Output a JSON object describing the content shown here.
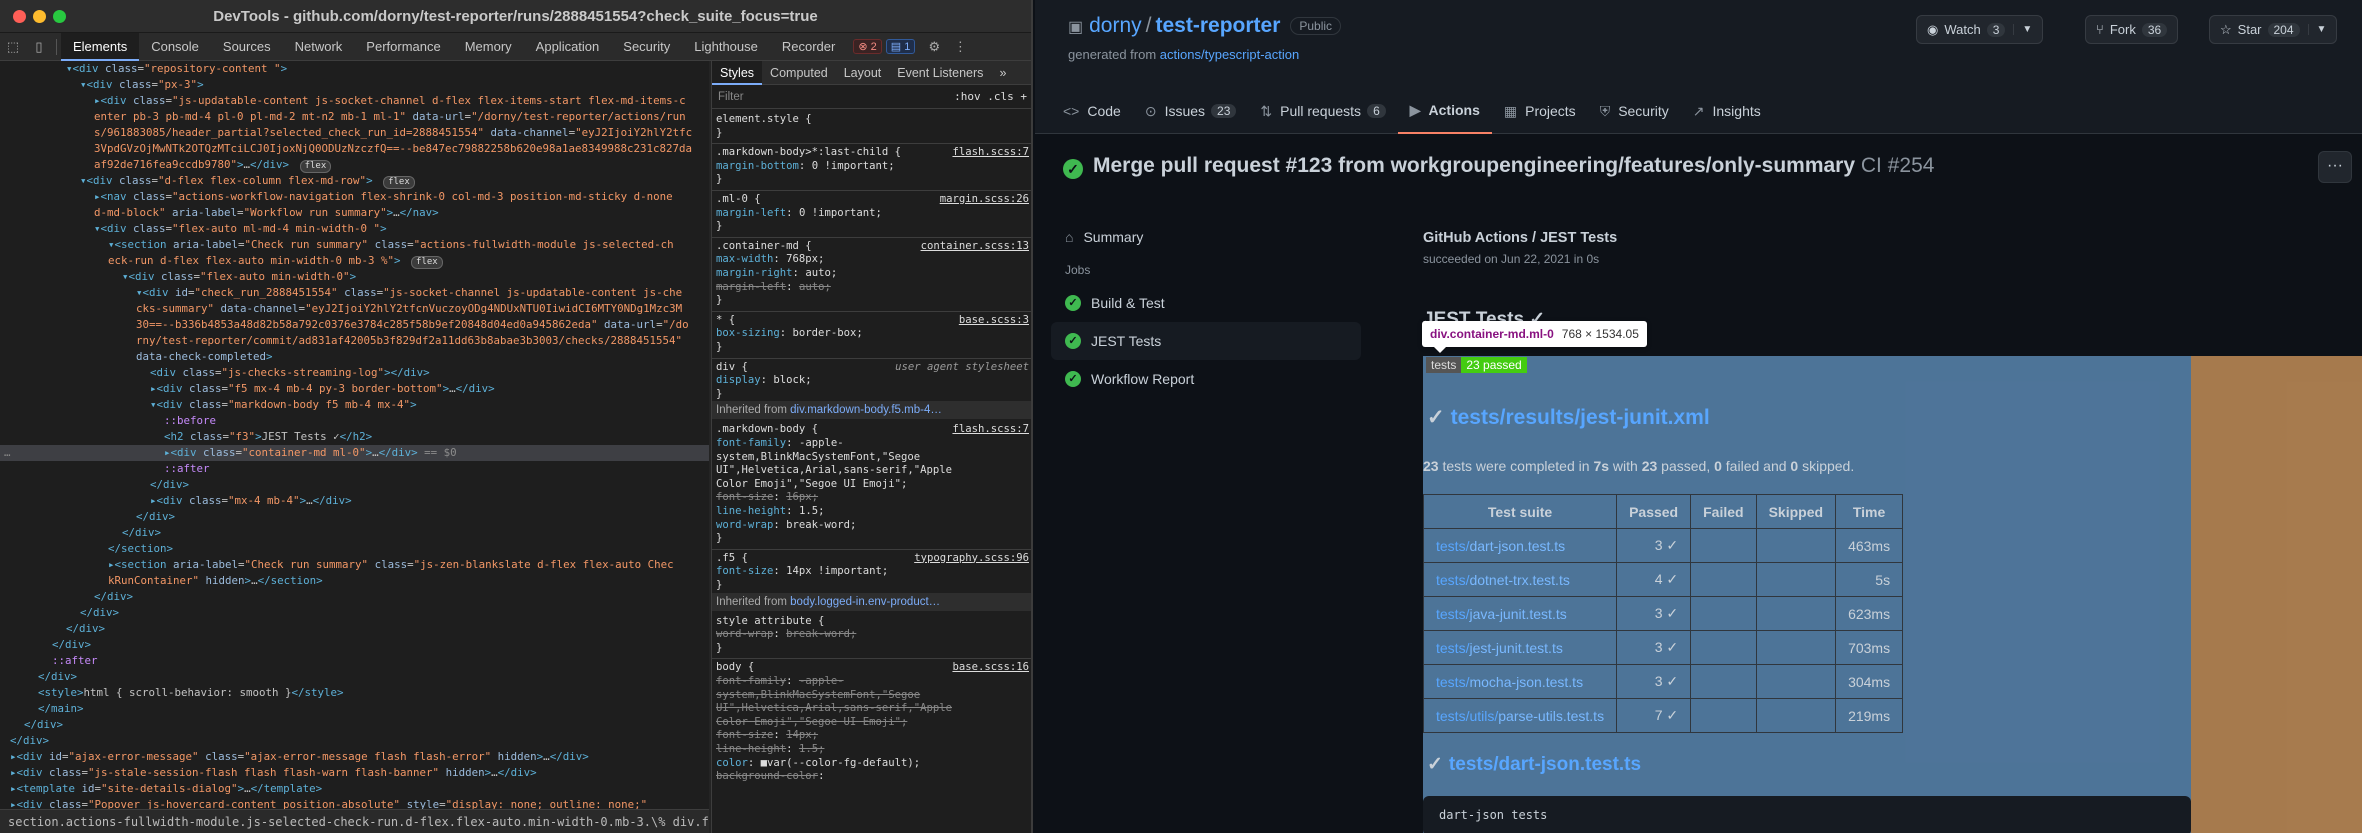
{
  "devtools": {
    "window_title": "DevTools - github.com/dorny/test-reporter/runs/2888451554?check_suite_focus=true",
    "tabs": [
      "Elements",
      "Console",
      "Sources",
      "Network",
      "Performance",
      "Memory",
      "Application",
      "Security",
      "Lighthouse",
      "Recorder"
    ],
    "active_tab": "Elements",
    "errors_count": "2",
    "messages_count": "1",
    "dom_lines": [
      {
        "i": 4,
        "h": "<span class='tg'>▾&lt;div </span><span class='an'>class</span>=<span class='av'>\"repository-content \"</span><span class='tg'>&gt;</span>"
      },
      {
        "i": 5,
        "h": "<span class='tg'>▾&lt;div </span><span class='an'>class</span>=<span class='av'>\"px-3\"</span><span class='tg'>&gt;</span>"
      },
      {
        "i": 6,
        "h": "<span class='tg'>▸&lt;div </span><span class='an'>class</span>=<span class='av'>\"js-updatable-content js-socket-channel d-flex flex-items-start flex-md-items-c</span>"
      },
      {
        "i": 6,
        "h": "<span class='av'>enter pb-3 pb-md-4 pl-0 pl-md-2 mt-n2 mb-1 ml-1\"</span> <span class='an'>data-url</span>=<span class='av'>\"/dorny/test-reporter/actions/run</span>"
      },
      {
        "i": 6,
        "h": "<span class='av'>s/961883085/header_partial?selected_check_run_id=2888451554\"</span> <span class='an'>data-channel</span>=<span class='av'>\"eyJ2IjoiY2hlY2tfc</span>"
      },
      {
        "i": 6,
        "h": "<span class='av'>3VpdGVzOjMwNTk2OTQzMTciLCJ0IjoxNjQ0ODUzNzczfQ==--be847ec79882258b620e98a1ae8349988c231c827da</span>"
      },
      {
        "i": 6,
        "h": "<span class='av'>af92de716fea9ccdb9780\"</span><span class='tg'>&gt;</span>…<span class='tg'>&lt;/div&gt;</span> <span class='flexb'>flex</span>"
      },
      {
        "i": 5,
        "h": "<span class='tg'>▾&lt;div </span><span class='an'>class</span>=<span class='av'>\"d-flex flex-column flex-md-row\"</span><span class='tg'>&gt;</span> <span class='flexb'>flex</span>"
      },
      {
        "i": 6,
        "h": "<span class='tg'>▸&lt;nav </span><span class='an'>class</span>=<span class='av'>\"actions-workflow-navigation flex-shrink-0 col-md-3 position-md-sticky d-none</span>"
      },
      {
        "i": 6,
        "h": "<span class='av'>d-md-block\"</span> <span class='an'>aria-label</span>=<span class='av'>\"Workflow run summary\"</span><span class='tg'>&gt;</span>…<span class='tg'>&lt;/nav&gt;</span>"
      },
      {
        "i": 6,
        "h": "<span class='tg'>▾&lt;div </span><span class='an'>class</span>=<span class='av'>\"flex-auto ml-md-4 min-width-0 \"</span><span class='tg'>&gt;</span>"
      },
      {
        "i": 7,
        "h": "<span class='tg'>▾&lt;section </span><span class='an'>aria-label</span>=<span class='av'>\"Check run summary\"</span> <span class='an'>class</span>=<span class='av'>\"actions-fullwidth-module js-selected-ch</span>"
      },
      {
        "i": 7,
        "h": "<span class='av'>eck-run d-flex flex-auto min-width-0 mb-3 %\"</span><span class='tg'>&gt;</span> <span class='flexb'>flex</span>"
      },
      {
        "i": 8,
        "h": "<span class='tg'>▾&lt;div </span><span class='an'>class</span>=<span class='av'>\"flex-auto min-width-0\"</span><span class='tg'>&gt;</span>"
      },
      {
        "i": 9,
        "h": "<span class='tg'>▾&lt;div </span><span class='an'>id</span>=<span class='av'>\"check_run_2888451554\"</span> <span class='an'>class</span>=<span class='av'>\"js-socket-channel js-updatable-content js-che</span>"
      },
      {
        "i": 9,
        "h": "<span class='av'>cks-summary\"</span> <span class='an'>data-channel</span>=<span class='av'>\"eyJ2IjoiY2hlY2tfcnVuczoyODg4NDUxNTU0IiwidCI6MTY0NDg1Mzc3M</span>"
      },
      {
        "i": 9,
        "h": "<span class='av'>30==--b336b4853a48d82b58a792c0376e3784c285f58b9ef20848d04ed0a945862eda\"</span> <span class='an'>data-url</span>=<span class='av'>\"/do</span>"
      },
      {
        "i": 9,
        "h": "<span class='av'>rny/test-reporter/commit/ad831af42005b3f829df2a11dd63b8abae3b3003/checks/2888451554\"</span>"
      },
      {
        "i": 9,
        "h": "<span class='an'>data-check-completed</span><span class='tg'>&gt;</span>"
      },
      {
        "i": 10,
        "h": "<span class='tg'>&lt;div </span><span class='an'>class</span>=<span class='av'>\"js-checks-streaming-log\"</span><span class='tg'>&gt;&lt;/div&gt;</span>"
      },
      {
        "i": 10,
        "h": "<span class='tg'>▸&lt;div </span><span class='an'>class</span>=<span class='av'>\"f5 mx-4 mb-4 py-3 border-bottom\"</span><span class='tg'>&gt;</span>…<span class='tg'>&lt;/div&gt;</span>"
      },
      {
        "i": 10,
        "h": "<span class='tg'>▾&lt;div </span><span class='an'>class</span>=<span class='av'>\"markdown-body f5 mb-4 mx-4\"</span><span class='tg'>&gt;</span>"
      },
      {
        "i": 11,
        "h": "<span class='pe'>::before</span>"
      },
      {
        "i": 11,
        "h": "<span class='tg'>&lt;h2 </span><span class='an'>class</span>=<span class='av'>\"f3\"</span><span class='tg'>&gt;</span>JEST Tests ✓<span class='tg'>&lt;/h2&gt;</span>"
      },
      {
        "i": 11,
        "h": "<span class='tg'>▸&lt;div </span><span class='an'>class</span>=<span class='av'>\"container-md ml-0\"</span><span class='tg'>&gt;</span>…<span class='tg'>&lt;/div&gt;</span> <span class='ar'>== $0</span>",
        "sel": true
      },
      {
        "i": 11,
        "h": "<span class='pe'>::after</span>"
      },
      {
        "i": 10,
        "h": "<span class='tg'>&lt;/div&gt;</span>"
      },
      {
        "i": 10,
        "h": "<span class='tg'>▸&lt;div </span><span class='an'>class</span>=<span class='av'>\"mx-4 mb-4\"</span><span class='tg'>&gt;</span>…<span class='tg'>&lt;/div&gt;</span>"
      },
      {
        "i": 9,
        "h": "<span class='tg'>&lt;/div&gt;</span>"
      },
      {
        "i": 8,
        "h": "<span class='tg'>&lt;/div&gt;</span>"
      },
      {
        "i": 7,
        "h": "<span class='tg'>&lt;/section&gt;</span>"
      },
      {
        "i": 7,
        "h": "<span class='tg'>▸&lt;section </span><span class='an'>aria-label</span>=<span class='av'>\"Check run summary\"</span> <span class='an'>class</span>=<span class='av'>\"js-zen-blankslate d-flex flex-auto Chec</span>"
      },
      {
        "i": 7,
        "h": "<span class='av'>kRunContainer\"</span> <span class='an'>hidden</span><span class='tg'>&gt;</span>…<span class='tg'>&lt;/section&gt;</span>"
      },
      {
        "i": 6,
        "h": "<span class='tg'>&lt;/div&gt;</span>"
      },
      {
        "i": 5,
        "h": "<span class='tg'>&lt;/div&gt;</span>"
      },
      {
        "i": 4,
        "h": "<span class='tg'>&lt;/div&gt;</span>"
      },
      {
        "i": 3,
        "h": "<span class='tg'>&lt;/div&gt;</span>"
      },
      {
        "i": 3,
        "h": "<span class='pe'>::after</span>"
      },
      {
        "i": 2,
        "h": "<span class='tg'>&lt;/div&gt;</span>"
      },
      {
        "i": 2,
        "h": "<span class='tg'>&lt;style&gt;</span>html { scroll-behavior: smooth }<span class='tg'>&lt;/style&gt;</span>"
      },
      {
        "i": 2,
        "h": "<span class='tg'>&lt;/main&gt;</span>"
      },
      {
        "i": 1,
        "h": "<span class='tg'>&lt;/div&gt;</span>"
      },
      {
        "i": 0,
        "h": "<span class='tg'>&lt;/div&gt;</span>"
      },
      {
        "i": 0,
        "h": "<span class='tg'>▸&lt;div </span><span class='an'>id</span>=<span class='av'>\"ajax-error-message\"</span> <span class='an'>class</span>=<span class='av'>\"ajax-error-message flash flash-error\"</span> <span class='an'>hidden</span><span class='tg'>&gt;</span>…<span class='tg'>&lt;/div&gt;</span>"
      },
      {
        "i": 0,
        "h": "<span class='tg'>▸&lt;div </span><span class='an'>class</span>=<span class='av'>\"js-stale-session-flash flash flash-warn flash-banner\"</span> <span class='an'>hidden</span><span class='tg'>&gt;</span>…<span class='tg'>&lt;/div&gt;</span>"
      },
      {
        "i": 0,
        "h": "<span class='tg'>▸&lt;template </span><span class='an'>id</span>=<span class='av'>\"site-details-dialog\"</span><span class='tg'>&gt;</span>…<span class='tg'>&lt;/template&gt;</span>"
      },
      {
        "i": 0,
        "h": "<span class='tg'>▸&lt;div </span><span class='an'>class</span>=<span class='av'>\"Popover js-hovercard-content position-absolute\"</span> <span class='an'>style</span>=<span class='av'>\"display: none; outline: none;\"</span>"
      },
      {
        "i": 0,
        "h": "<span class='an'>tabindex</span>=<span class='av'>\"0\"</span><span class='tg'>&gt;</span>…<span class='tg'>&lt;/div&gt;</span>"
      }
    ],
    "breadcrumbs": "section.actions-fullwidth-module.js-selected-check-run.d-flex.flex-auto.min-width-0.mb-3.\\%   div.flex-auto.min-width-0",
    "styles_tabs": [
      "Styles",
      "Computed",
      "Layout",
      "Event Listeners",
      "»"
    ],
    "filter_placeholder": "Filter",
    "filter_right": ":hov  .cls  +",
    "style_lines": [
      {
        "h": "element.style {"
      },
      {
        "h": "}"
      },
      {
        "div": true
      },
      {
        "h": ".markdown-body&gt;*:last-child {",
        "src": "flash.scss:7"
      },
      {
        "h": "  <span class='pn'>margin-bottom</span>: <span class='pv'>0 !important;</span>"
      },
      {
        "h": "}"
      },
      {
        "div": true
      },
      {
        "h": ".ml-0 {",
        "src": "margin.scss:26"
      },
      {
        "h": "  <span class='pn'>margin-left</span>: <span class='pv'>0 !important;</span>"
      },
      {
        "h": "}"
      },
      {
        "div": true
      },
      {
        "h": ".container-md {",
        "src": "container.scss:13"
      },
      {
        "h": "  <span class='pn'>max-width</span>: <span class='pv'>768px;</span>"
      },
      {
        "h": "  <span class='pn'>margin-right</span>: <span class='pv'>auto;</span>"
      },
      {
        "h": "  <span class='pn'>margin-left</span>: <span class='pv'>auto;</span>",
        "strike": true
      },
      {
        "h": "}"
      },
      {
        "div": true
      },
      {
        "h": "* {",
        "src": "base.scss:3"
      },
      {
        "h": "  <span class='pn'>box-sizing</span>: <span class='pv'>border-box;</span>"
      },
      {
        "h": "}"
      },
      {
        "div": true
      },
      {
        "h": "div {",
        "ua": "user agent stylesheet"
      },
      {
        "h": "  <span class='pn'>display</span>: <span class='pv'>block;</span>"
      },
      {
        "h": "}"
      },
      {
        "inh": "Inherited from ",
        "lk": "div.markdown-body.f5.mb-4…"
      },
      {
        "h": ".markdown-body {",
        "src": "flash.scss:7"
      },
      {
        "h": "  <span class='pn'>font-family</span>: <span class='pv'>-apple-</span>"
      },
      {
        "h": "     <span class='pv'>system,BlinkMacSystemFont,\"Segoe</span>"
      },
      {
        "h": "     <span class='pv'>UI\",Helvetica,Arial,sans-serif,\"Apple</span>"
      },
      {
        "h": "     <span class='pv'>Color Emoji\",\"Segoe UI Emoji\";</span>"
      },
      {
        "h": "  <span class='pn'>font-size</span>: <span class='pv'>16px;</span>",
        "strike": true
      },
      {
        "h": "  <span class='pn'>line-height</span>: <span class='pv'>1.5;</span>"
      },
      {
        "h": "  <span class='pn'>word-wrap</span>: <span class='pv'>break-word;</span>"
      },
      {
        "h": "}"
      },
      {
        "div": true
      },
      {
        "h": ".f5 {",
        "src": "typography.scss:96"
      },
      {
        "h": "  <span class='pn'>font-size</span>: <span class='pv'>14px !important;</span>"
      },
      {
        "h": "}"
      },
      {
        "inh": "Inherited from ",
        "lk": "body.logged-in.env-product…"
      },
      {
        "h": "style attribute {"
      },
      {
        "h": "  <span class='pn'>word-wrap</span>: <span class='pv'>break-word;</span>",
        "strike": true
      },
      {
        "h": "}"
      },
      {
        "div": true
      },
      {
        "h": "body {",
        "src": "base.scss:16"
      },
      {
        "h": "  <span class='pn'>font-family</span>: <span class='pv'>-apple-</span>",
        "strike": true
      },
      {
        "h": "     <span class='pv'>system,BlinkMacSystemFont,\"Segoe</span>",
        "strike": true
      },
      {
        "h": "     <span class='pv'>UI\",Helvetica,Arial,sans-serif,\"Apple</span>",
        "strike": true
      },
      {
        "h": "     <span class='pv'>Color Emoji\",\"Segoe UI Emoji\";</span>",
        "strike": true
      },
      {
        "h": "  <span class='pn'>font-size</span>: <span class='pv'>14px;</span>",
        "strike": true
      },
      {
        "h": "  <span class='pn'>line-height</span>: <span class='pv'>1.5;</span>",
        "strike": true
      },
      {
        "h": "  <span class='pn'>color</span>: <span class='pv'>■var(--color-fg-default);</span>"
      },
      {
        "h": "  <span class='pn'>background-color</span>:",
        "strike": true
      }
    ]
  },
  "github": {
    "owner": "dorny",
    "repo": "test-reporter",
    "visibility": "Public",
    "generated_from_prefix": "generated from",
    "generated_from_link": "actions/typescript-action",
    "watch_label": "Watch",
    "watch_count": "3",
    "fork_label": "Fork",
    "fork_count": "36",
    "star_label": "Star",
    "star_count": "204",
    "nav": [
      {
        "label": "Code",
        "icon": "<>"
      },
      {
        "label": "Issues",
        "icon": "⊙",
        "count": "23"
      },
      {
        "label": "Pull requests",
        "icon": "⇅",
        "count": "6"
      },
      {
        "label": "Actions",
        "icon": "▶",
        "active": true
      },
      {
        "label": "Projects",
        "icon": "▦"
      },
      {
        "label": "Security",
        "icon": "⛨"
      },
      {
        "label": "Insights",
        "icon": "↗"
      }
    ],
    "run_title": "Merge pull request #123 from workgroupengineering/features/only-summary",
    "run_suffix": "CI #254",
    "sidebar": {
      "summary": "Summary",
      "jobs_heading": "Jobs",
      "jobs": [
        "Build & Test",
        "JEST Tests",
        "Workflow Report"
      ],
      "active_job": "JEST Tests"
    },
    "job_title": "GitHub Actions / JEST Tests",
    "job_subtitle": "succeeded on Jun 22, 2021 in 0s",
    "jest_heading": "JEST Tests ✓",
    "tooltip_name": "div.container-md.ml-0",
    "tooltip_dims": "768 × 1534.05",
    "badge_left": "tests",
    "badge_right": "23 passed",
    "report1": "tests/results/jest-junit.xml",
    "summary_parts": {
      "n1": "23",
      "t1": " tests were completed in ",
      "n2": "7s",
      "t2": " with ",
      "n3": "23",
      "t3": " passed, ",
      "n4": "0",
      "t4": " failed and ",
      "n5": "0",
      "t5": " skipped."
    },
    "table": {
      "headers": [
        "Test suite",
        "Passed",
        "Failed",
        "Skipped",
        "Time"
      ],
      "rows": [
        {
          "dir": "tests/",
          "file": "dart-json.test.ts",
          "passed": "3 ✓",
          "time": "463ms"
        },
        {
          "dir": "tests/",
          "file": "dotnet-trx.test.ts",
          "passed": "4 ✓",
          "time": "5s"
        },
        {
          "dir": "tests/",
          "file": "java-junit.test.ts",
          "passed": "3 ✓",
          "time": "623ms"
        },
        {
          "dir": "tests/",
          "file": "jest-junit.test.ts",
          "passed": "3 ✓",
          "time": "703ms"
        },
        {
          "dir": "tests/",
          "file": "mocha-json.test.ts",
          "passed": "3 ✓",
          "time": "304ms"
        },
        {
          "dir": "tests/utils/",
          "file": "parse-utils.test.ts",
          "passed": "7 ✓",
          "time": "219ms"
        }
      ]
    },
    "report2": "tests/dart-json.test.ts",
    "code_text": "dart-json tests"
  }
}
